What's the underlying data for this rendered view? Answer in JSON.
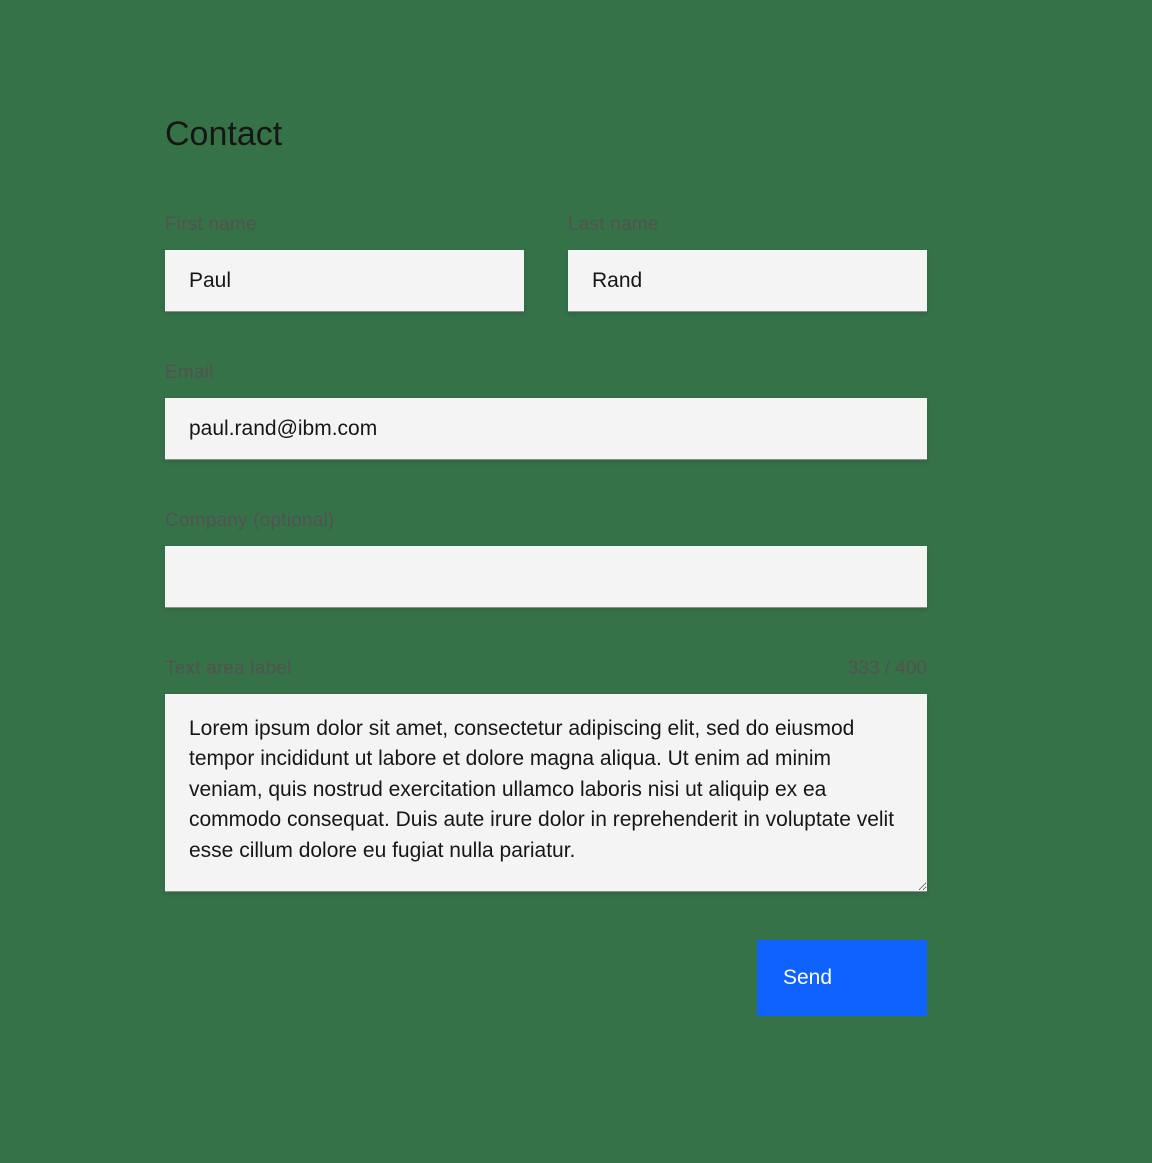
{
  "heading": "Contact",
  "first_name": {
    "label": "First name",
    "value": "Paul"
  },
  "last_name": {
    "label": "Last name",
    "value": "Rand"
  },
  "email": {
    "label": "Email",
    "value": "paul.rand@ibm.com"
  },
  "company": {
    "label": "Company (optional)",
    "value": ""
  },
  "message": {
    "label": "Text area label",
    "counter": "333 / 400",
    "value": "Lorem ipsum dolor sit amet, consectetur adipiscing elit, sed do eiusmod tempor incididunt ut labore et dolore magna aliqua. Ut enim ad minim veniam, quis nostrud exercitation ullamco laboris nisi ut aliquip ex ea commodo consequat. Duis aute irure dolor in reprehenderit in voluptate velit esse cillum dolore eu fugiat nulla pariatur."
  },
  "send_label": "Send"
}
